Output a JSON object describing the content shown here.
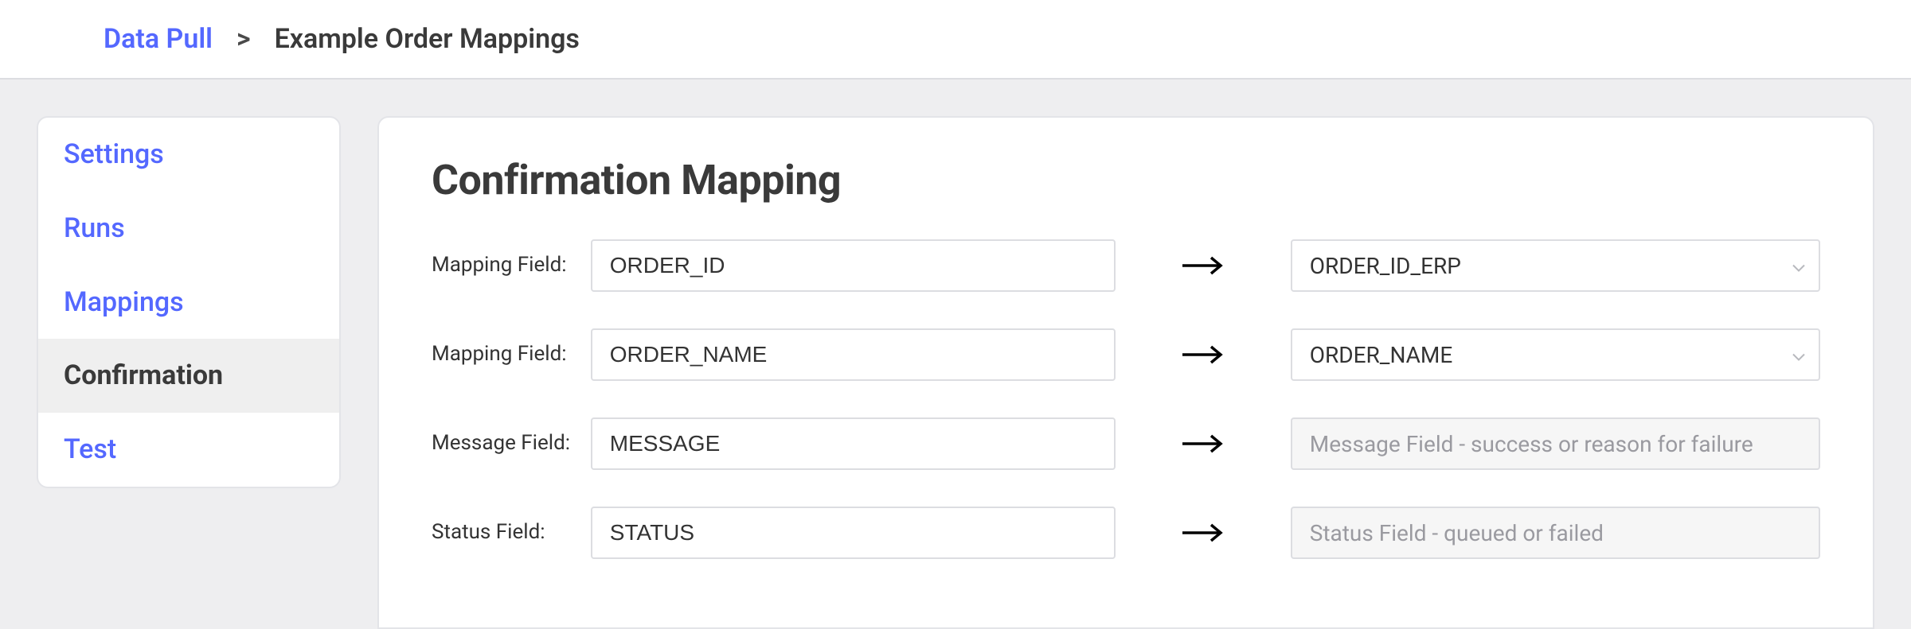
{
  "breadcrumb": {
    "root": "Data Pull",
    "separator": ">",
    "current": "Example Order Mappings"
  },
  "sidebar": {
    "items": [
      {
        "label": "Settings"
      },
      {
        "label": "Runs"
      },
      {
        "label": "Mappings"
      },
      {
        "label": "Confirmation"
      },
      {
        "label": "Test"
      }
    ],
    "active_index": 3
  },
  "panel": {
    "title": "Confirmation Mapping",
    "rows": [
      {
        "label": "Mapping Field:",
        "left_value": "ORDER_ID",
        "right_type": "select",
        "right_value": "ORDER_ID_ERP"
      },
      {
        "label": "Mapping Field:",
        "left_value": "ORDER_NAME",
        "right_type": "select",
        "right_value": "ORDER_NAME"
      },
      {
        "label": "Message Field:",
        "left_value": "MESSAGE",
        "right_type": "disabled",
        "right_placeholder": "Message Field - success or reason for failure"
      },
      {
        "label": "Status Field:",
        "left_value": "STATUS",
        "right_type": "disabled",
        "right_placeholder": "Status Field - queued or failed"
      }
    ]
  }
}
